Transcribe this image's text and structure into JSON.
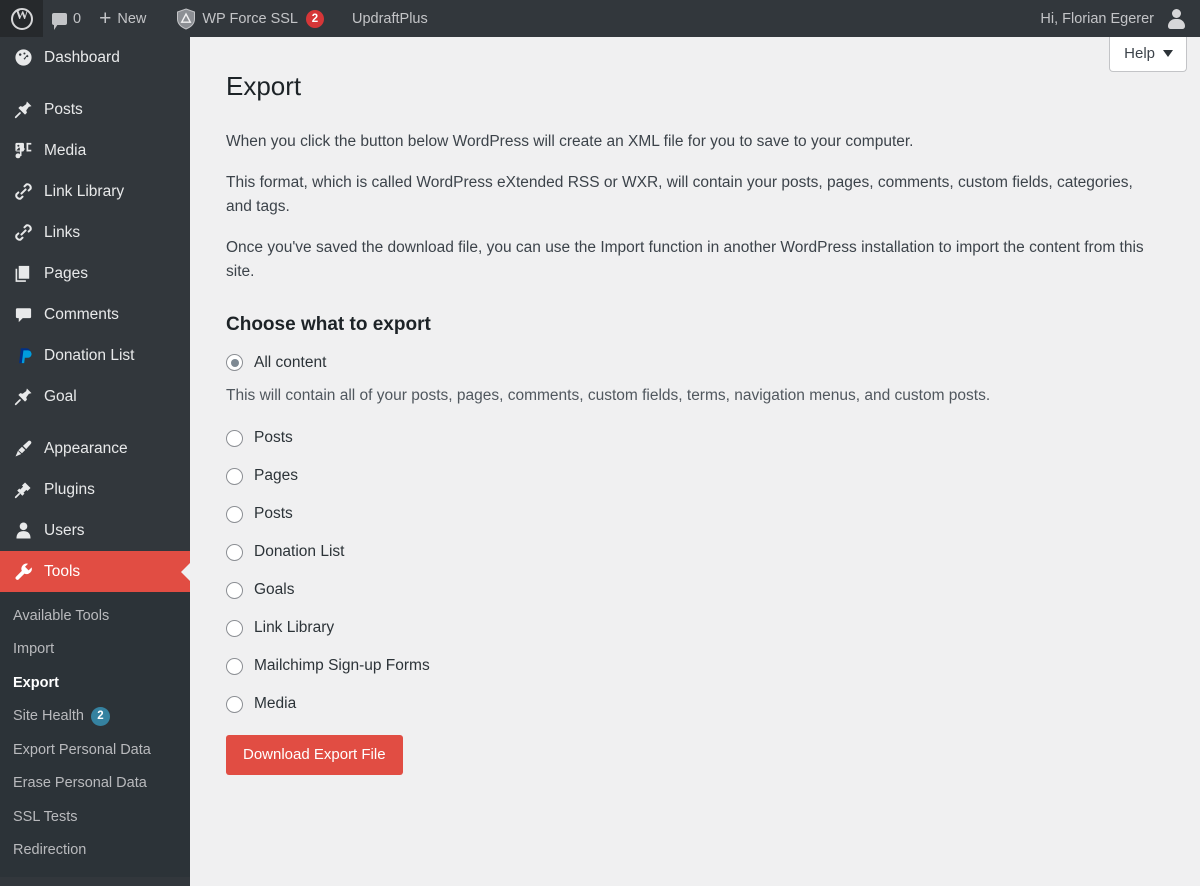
{
  "adminbar": {
    "wp_logo": "wordpress-logo",
    "comments_count": "0",
    "new_label": "New",
    "force_ssl_label": "WP Force SSL",
    "force_ssl_badge": "2",
    "updraft_label": "UpdraftPlus",
    "greeting": "Hi, Florian Egerer",
    "background": "#32373c"
  },
  "sidebar": {
    "background": "#32373c",
    "submenu_background": "#2c3338",
    "current_color": "#e14d43",
    "badge_color": "#3582a0",
    "items": [
      {
        "label": "Dashboard",
        "icon": "dashboard-icon"
      },
      {
        "label": "Posts",
        "icon": "pin-icon"
      },
      {
        "label": "Media",
        "icon": "media-icon"
      },
      {
        "label": "Link Library",
        "icon": "link-icon"
      },
      {
        "label": "Links",
        "icon": "link-icon"
      },
      {
        "label": "Pages",
        "icon": "pages-icon"
      },
      {
        "label": "Comments",
        "icon": "comment-icon"
      },
      {
        "label": "Donation List",
        "icon": "paypal-icon"
      },
      {
        "label": "Goal",
        "icon": "pin-icon"
      },
      {
        "label": "Appearance",
        "icon": "paintbrush-icon"
      },
      {
        "label": "Plugins",
        "icon": "plug-icon"
      },
      {
        "label": "Users",
        "icon": "user-icon"
      },
      {
        "label": "Tools",
        "icon": "wrench-icon",
        "current": true
      }
    ],
    "submenu": [
      {
        "label": "Available Tools"
      },
      {
        "label": "Import"
      },
      {
        "label": "Export",
        "current": true
      },
      {
        "label": "Site Health",
        "badge": "2"
      },
      {
        "label": "Export Personal Data"
      },
      {
        "label": "Erase Personal Data"
      },
      {
        "label": "SSL Tests"
      },
      {
        "label": "Redirection"
      }
    ]
  },
  "help_tab": {
    "label": "Help"
  },
  "main": {
    "title": "Export",
    "paragraph1": "When you click the button below WordPress will create an XML file for you to save to your computer.",
    "paragraph2": "This format, which is called WordPress eXtended RSS or WXR, will contain your posts, pages, comments, custom fields, categories, and tags.",
    "paragraph3": "Once you've saved the download file, you can use the Import function in another WordPress installation to import the content from this site.",
    "section_title": "Choose what to export",
    "all_content_label": "All content",
    "all_content_desc": "This will contain all of your posts, pages, comments, custom fields, terms, navigation menus, and custom posts.",
    "options": [
      {
        "label": "Posts"
      },
      {
        "label": "Pages"
      },
      {
        "label": "Posts"
      },
      {
        "label": "Donation List"
      },
      {
        "label": "Goals"
      },
      {
        "label": "Link Library"
      },
      {
        "label": "Mailchimp Sign-up Forms"
      },
      {
        "label": "Media"
      }
    ],
    "submit_label": "Download Export File",
    "submit_color": "#e14d43"
  }
}
